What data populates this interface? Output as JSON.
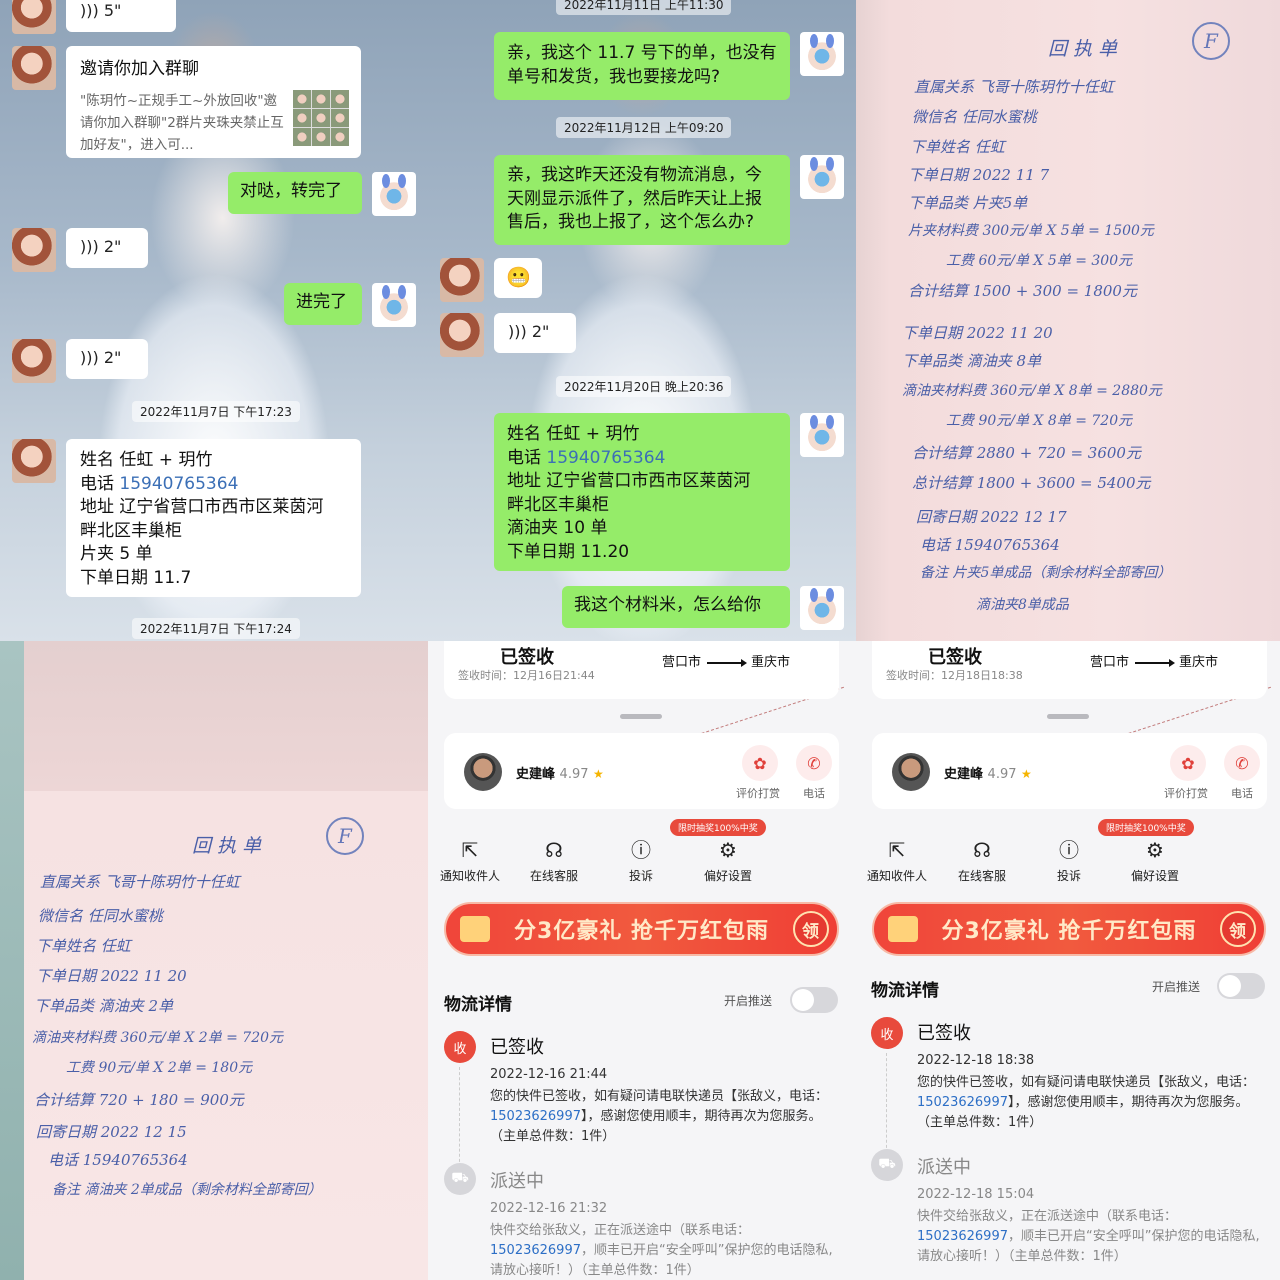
{
  "chat1": {
    "voice_top": "5\"",
    "invite": {
      "title": "邀请你加入群聊",
      "desc": "\"陈玥竹~正规手工~外放回收\"邀请你加入群聊\"2群片夹珠夹禁止互加好友\"，进入可..."
    },
    "msg_transferred": "对哒，转完了",
    "voice_2a": "2\"",
    "msg_joined": "进完了",
    "voice_2b": "2\"",
    "time_1": "2022年11月7日 下午17:23",
    "order": {
      "name": "姓名 任虹 + 玥竹",
      "phone_label": "电话 ",
      "phone": "15940765364",
      "address_1": "地址 辽宁省营口市西市区莱茵河",
      "address_2": "畔北区丰巢柜",
      "item": "片夹 5 单",
      "date": "下单日期 11.7"
    },
    "time_2": "2022年11月7日 下午17:24"
  },
  "chat2": {
    "time_top": "2022年11月11日 上午11:30",
    "msg_1": "亲，我这个 11.7 号下的单，也没有单号和发货，我也要接龙吗?",
    "time_2": "2022年11月12日 上午09:20",
    "msg_2": "亲，我这昨天还没有物流消息，今天刚显示派件了，然后昨天让上报售后，我也上报了，这个怎么办?",
    "emoji": "😬",
    "voice": "2\"",
    "time_3": "2022年11月20日 晚上20:36",
    "order": {
      "name": "姓名 任虹 + 玥竹",
      "phone_label": "电话 ",
      "phone": "15940765364",
      "address_1": "地址 辽宁省营口市西市区莱茵河",
      "address_2": "畔北区丰巢柜",
      "item": "滴油夹 10 单",
      "date": "下单日期 11.20"
    },
    "msg_3": "我这个材料米，怎么给你"
  },
  "note1": {
    "title": "回 执 单",
    "circle": "F",
    "lines": [
      "直属关系   飞哥十陈玥竹十任虹",
      "微信名   任同水蜜桃",
      "下单姓名   任虹",
      "下单日期   2022  11  7",
      "下单品类   片夹5单",
      "片夹材料费  300元/单 X 5单 = 1500元",
      "工费   60元/单 X 5单 = 300元",
      "合计结算   1500 + 300 = 1800元",
      "下单日期   2022  11  20",
      "下单品类   滴油夹 8单",
      "滴油夹材料费  360元/单 X 8单 = 2880元",
      "工费   90元/单 X 8单 = 720元",
      "合计结算   2880 + 720 = 3600元",
      "总计结算   1800 + 3600 = 5400元",
      "回寄日期   2022  12  17",
      "电话   15940765364",
      "备注   片夹5单成品（剩余材料全部寄回）",
      "滴油夹8单成品"
    ]
  },
  "note2": {
    "title": "回 执 单",
    "circle": "F",
    "lines": [
      "直属关系   飞哥十陈玥竹十任虹",
      "微信名   任同水蜜桃",
      "下单姓名   任虹",
      "下单日期   2022  11  20",
      "下单品类   滴油夹 2单",
      "滴油夹材料费  360元/单 X 2单 = 720元",
      "工费   90元/单 X 2单 = 180元",
      "合计结算   720 + 180 = 900元",
      "回寄日期   2022  12  15",
      "电话   15940765364",
      "备注   滴油夹 2单成品（剩余材料全部寄回）"
    ]
  },
  "sf1": {
    "status": "已签收",
    "sign_time": "签收时间：12月16日21:44",
    "from": "营口市",
    "to": "重庆市",
    "courier_name": "史建峰",
    "courier_rating": "4.97",
    "rate_label": "评价打赏",
    "call_label": "电话",
    "promo": "限时抽奖100%中奖",
    "actions": [
      "通知收件人",
      "在线客服",
      "投诉",
      "偏好设置"
    ],
    "banner": "分3亿豪礼 抢千万红包雨",
    "banner_btn": "领",
    "logistics_title": "物流详情",
    "push_label": "开启推送",
    "tl1": {
      "badge": "收",
      "status": "已签收",
      "time": "2022-12-16 21:44",
      "desc_1": "您的快件已签收，如有疑问请电联快递员【张敌义，电话：",
      "phone": "15023626997",
      "desc_2": "】，感谢您使用顺丰，期待再次为您服务。（主单总件数：1件）"
    },
    "tl2": {
      "status": "派送中",
      "time": "2022-12-16 21:32",
      "desc_1": "快件交给张敌义，正在派送途中（联系电话：",
      "phone": "15023626997",
      "desc_2": "，顺丰已开启“安全呼叫”保护您的电话隐私,请放心接听！）（主单总件数：1件）"
    }
  },
  "sf2": {
    "status": "已签收",
    "sign_time": "签收时间：12月18日18:38",
    "from": "营口市",
    "to": "重庆市",
    "courier_name": "史建峰",
    "courier_rating": "4.97",
    "rate_label": "评价打赏",
    "call_label": "电话",
    "promo": "限时抽奖100%中奖",
    "actions": [
      "通知收件人",
      "在线客服",
      "投诉",
      "偏好设置"
    ],
    "banner": "分3亿豪礼 抢千万红包雨",
    "banner_btn": "领",
    "logistics_title": "物流详情",
    "push_label": "开启推送",
    "tl1": {
      "badge": "收",
      "status": "已签收",
      "time": "2022-12-18 18:38",
      "desc_1": "您的快件已签收，如有疑问请电联快递员【张敌义，电话：",
      "phone": "15023626997",
      "desc_2": "】，感谢您使用顺丰，期待再次为您服务。（主单总件数：1件）"
    },
    "tl2": {
      "status": "派送中",
      "time": "2022-12-18 15:04",
      "desc_1": "快件交给张敌义，正在派送途中（联系电话：",
      "phone": "15023626997",
      "desc_2": "，顺丰已开启“安全呼叫”保护您的电话隐私,请放心接听！）（主单总件数：1件）"
    }
  },
  "colors": {
    "wechat_green": "#95ec69",
    "sf_red": "#e84a3c",
    "link_blue": "#2d6fc6",
    "ink_blue": "#4a5fa8"
  }
}
